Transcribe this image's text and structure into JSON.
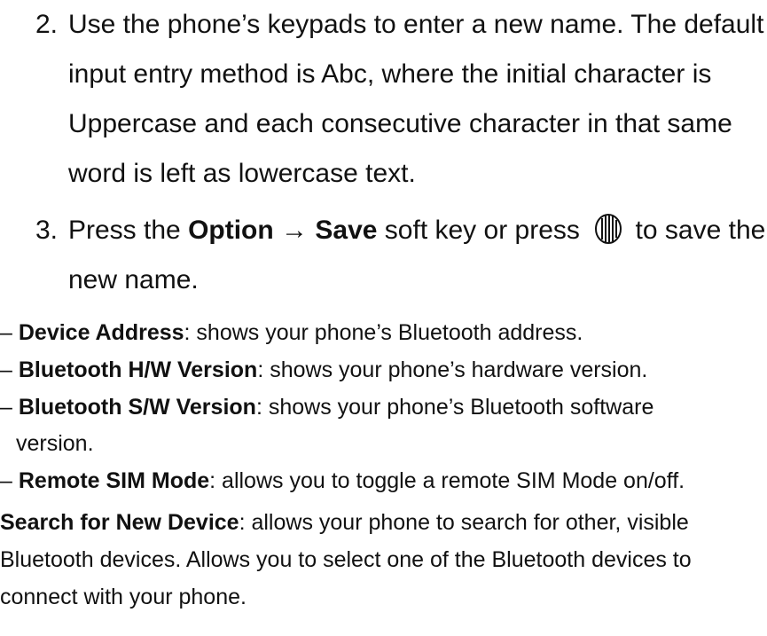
{
  "step2": {
    "number": "2.",
    "lines": [
      "Use the phone’s keypads to enter a new name. The default",
      "input entry method is Abc, where the initial character is",
      "Uppercase and each consecutive character in that same",
      "word is left as lowercase text."
    ]
  },
  "step3": {
    "number": "3.",
    "before": "Press the ",
    "option": "Option",
    "arrow": "→",
    "save": "Save",
    "middle": " soft key or press ",
    "after": " to save the",
    "line2": "new name.",
    "icon": "center-select-key-icon"
  },
  "subitems": [
    {
      "dash": "–",
      "term": "Device Address",
      "desc": ": shows your phone’s Bluetooth address."
    },
    {
      "dash": "–",
      "term": "Bluetooth H/W Version",
      "desc": ": shows your phone’s hardware version."
    },
    {
      "dash": "–",
      "term": "Bluetooth S/W Version",
      "desc": ": shows your phone’s Bluetooth software",
      "cont": "version."
    },
    {
      "dash": "–",
      "term": "Remote SIM Mode",
      "desc": ": allows you to toggle a remote SIM Mode on/off."
    }
  ],
  "bullet": {
    "term": "Search for New Device",
    "desc": ": allows your phone to search for other, visible",
    "line2": "Bluetooth devices. Allows you to select one of the Bluetooth devices to",
    "line3": "connect with your phone."
  }
}
